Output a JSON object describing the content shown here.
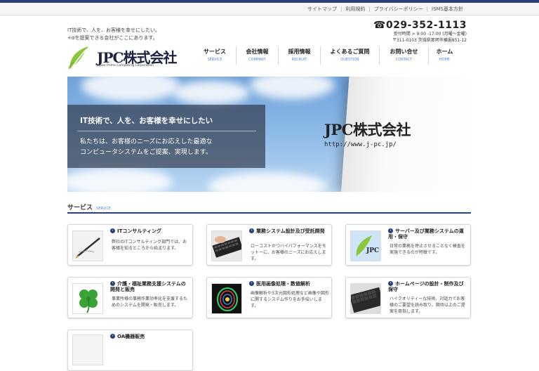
{
  "utility_links": [
    "サイトマップ",
    "利用規約",
    "プライバシーポリシー",
    "ISMS基本方針"
  ],
  "header": {
    "tagline": [
      "IT技術で、人を、お客様を幸せにしたい。",
      "+αを提案できる会社がここにあります。"
    ],
    "logo_text": "JPC株式会社",
    "logo_sub": "Japan Prime Computing Corporation",
    "tel": "☎029-352-1113",
    "hours": "受付時間 > 9:00 -17:00 (月曜～金曜)",
    "address": "〒311-0103 茨城県那珂市横堀851-12"
  },
  "nav": [
    {
      "jp": "サービス",
      "en": "SERVICE"
    },
    {
      "jp": "会社情報",
      "en": "COMPANY"
    },
    {
      "jp": "採用情報",
      "en": "RECRUIT"
    },
    {
      "jp": "よくあるご質問",
      "en": "QUESTION"
    },
    {
      "jp": "お問い合せ",
      "en": "CONTACT"
    },
    {
      "jp": "ホーム",
      "en": "HOME"
    }
  ],
  "hero": {
    "headline": "IT技術で、人を、お客様を幸せにしたい",
    "body": [
      "私たちは、お客様のニーズにお応えした最適な",
      "コンピュータシステムをご提案、実現します。"
    ],
    "sign_title": "JPC株式会社",
    "sign_url": "http://www.j-pc.jp/"
  },
  "services_header": {
    "jp": "サービス",
    "en": "SERVICE"
  },
  "services": [
    {
      "title": "ITコンサルティング",
      "desc": "弊社のITコンサルティング部門では、お客様を知るところから始まります。"
    },
    {
      "title": "業務システム設計及び受託開発",
      "desc": "ローコストかつハイパフォーマンスをモットーに、お客様のニーズにお応えします。"
    },
    {
      "title": "サーバー及び業務システムの運用・保守",
      "desc": "日常の業務を停止させることなく検査を実施できるのが特徴です。"
    },
    {
      "title": "介護・福祉業務支援システムの開発と販売",
      "desc": "事業所様の事務作業効率化を支援するためのシステムを開発・販売します。"
    },
    {
      "title": "医用画像処理・数値解析",
      "desc": "画像解析や3次元図形処理など画像や図形に関するシステム作りをお手伝いします。"
    },
    {
      "title": "ホームページの設計・制作及び保守",
      "desc": "ハイクオリティーな技術、対話力でお客様のご要望を読み取り、期待以上のご提案を目指します。"
    },
    {
      "title": "OA機器販売",
      "desc": ""
    }
  ],
  "colors": {
    "navy": "#2b3f78",
    "accent_blue": "#5a86c8",
    "logo_green": "#8cc63f"
  }
}
